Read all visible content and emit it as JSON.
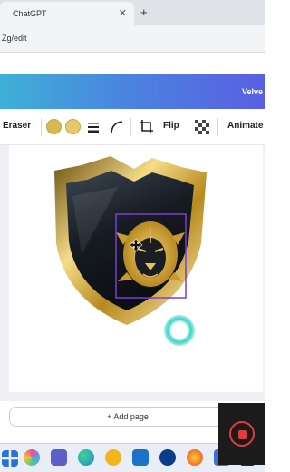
{
  "browser": {
    "tab_title": "ChatGPT",
    "tab_close": "✕",
    "new_tab": "+",
    "url": "Zg/edit"
  },
  "header": {
    "label": "Velve"
  },
  "toolbar": {
    "eraser": "Eraser",
    "flip": "Flip",
    "animate": "Animate",
    "swatch_colors": [
      "#d8b755",
      "#e6c96b"
    ]
  },
  "canvas": {
    "add_page": "+ Add page"
  },
  "colors": {
    "accent": "#4b82e0",
    "selection": "#7b3fcf",
    "cursor_ring": "#2ed3c4",
    "record": "#e23b3b"
  }
}
